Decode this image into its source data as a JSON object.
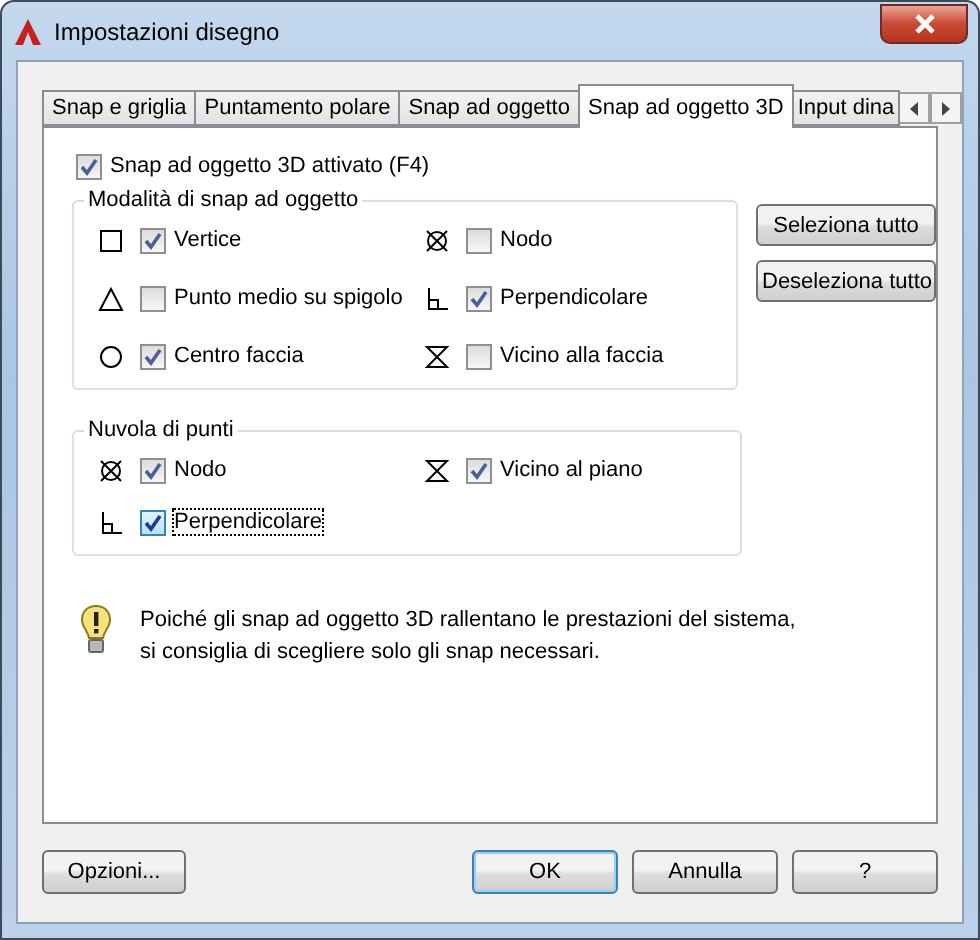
{
  "window": {
    "title": "Impostazioni disegno"
  },
  "tabs": [
    {
      "label": "Snap e griglia",
      "selected": false
    },
    {
      "label": "Puntamento polare",
      "selected": false
    },
    {
      "label": "Snap ad oggetto",
      "selected": false
    },
    {
      "label": "Snap ad oggetto 3D",
      "selected": true
    },
    {
      "label": "Input dina",
      "selected": false
    }
  ],
  "master_toggle": {
    "label": "Snap ad oggetto 3D attivato (F4)",
    "checked": true
  },
  "object_snap_modes": {
    "title": "Modalità di snap ad oggetto",
    "items": [
      {
        "label": "Vertice",
        "checked": true,
        "kind": "square"
      },
      {
        "label": "Nodo",
        "checked": false,
        "kind": "node"
      },
      {
        "label": "Punto medio su spigolo",
        "checked": false,
        "kind": "triangle"
      },
      {
        "label": "Perpendicolare",
        "checked": true,
        "kind": "perpendicular"
      },
      {
        "label": "Centro faccia",
        "checked": true,
        "kind": "circle"
      },
      {
        "label": "Vicino alla faccia",
        "checked": false,
        "kind": "hourglass"
      }
    ]
  },
  "side_buttons": [
    "Seleziona tutto",
    "Deseleziona tutto"
  ],
  "point_cloud": {
    "title": "Nuvola di punti",
    "items": [
      {
        "label": "Nodo",
        "checked": true,
        "focused": false,
        "kind": "node"
      },
      {
        "label": "Vicino al piano",
        "checked": true,
        "focused": false,
        "kind": "hourglass"
      },
      {
        "label": "Perpendicolare",
        "checked": true,
        "focused": true,
        "kind": "perpendicular"
      }
    ]
  },
  "note": {
    "lines": [
      "Poiché gli snap ad oggetto 3D rallentano le prestazioni del sistema,",
      "si consiglia di scegliere solo gli snap necessari."
    ]
  },
  "buttons": [
    {
      "label": "Opzioni...",
      "default": false
    },
    {
      "label": "OK",
      "default": true
    },
    {
      "label": "Annulla",
      "default": false
    },
    {
      "label": "?",
      "default": false
    }
  ]
}
